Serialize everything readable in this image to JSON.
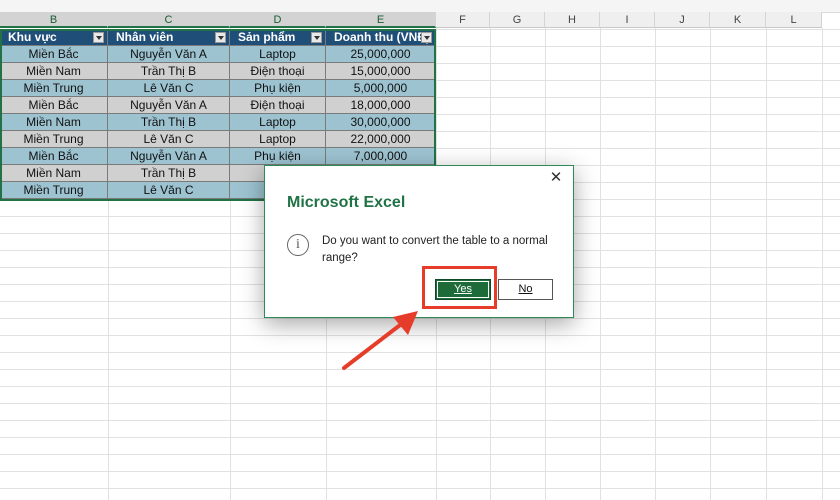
{
  "columns": [
    "B",
    "C",
    "D",
    "E",
    "F",
    "G",
    "H",
    "I",
    "J",
    "K",
    "L"
  ],
  "table": {
    "headers": [
      "Khu vực",
      "Nhân viên",
      "Sản phẩm",
      "Doanh thu (VNĐ)"
    ],
    "rows": [
      [
        "Miền Bắc",
        "Nguyễn Văn A",
        "Laptop",
        "25,000,000"
      ],
      [
        "Miền Nam",
        "Trần Thị B",
        "Điện thoại",
        "15,000,000"
      ],
      [
        "Miền Trung",
        "Lê Văn C",
        "Phụ kiện",
        "5,000,000"
      ],
      [
        "Miền Bắc",
        "Nguyễn Văn A",
        "Điện thoại",
        "18,000,000"
      ],
      [
        "Miền Nam",
        "Trần Thị B",
        "Laptop",
        "30,000,000"
      ],
      [
        "Miền Trung",
        "Lê Văn C",
        "Laptop",
        "22,000,000"
      ],
      [
        "Miền Bắc",
        "Nguyễn Văn A",
        "Phụ kiện",
        "7,000,000"
      ],
      [
        "Miền Nam",
        "Trần Thị B",
        "Điện",
        ""
      ],
      [
        "Miền Trung",
        "Lê Văn C",
        "Đi",
        ""
      ]
    ]
  },
  "dialog": {
    "title": "Microsoft Excel",
    "close_glyph": "✕",
    "info_glyph": "i",
    "message": "Do you want to convert the table to a normal range?",
    "yes_label": "Yes",
    "no_label": "No"
  },
  "colors": {
    "header_bg": "#1f4e79",
    "row_blue": "#9dc3d1",
    "row_gray": "#d0d0d0",
    "excel_green": "#217346",
    "annotation_red": "#e63c2a"
  },
  "icons": [
    "close-icon",
    "info-icon",
    "filter-dropdown-icon",
    "annotation-arrow"
  ]
}
